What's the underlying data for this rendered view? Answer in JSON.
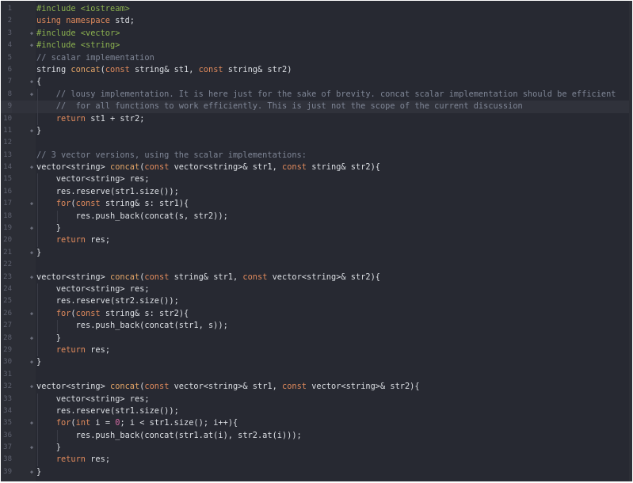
{
  "editor": {
    "theme": {
      "background": "#272932",
      "gutter": "#2b2d35",
      "preprocessor": "#8bb14f",
      "keyword": "#e08a5c",
      "function": "#e3a466",
      "comment": "#7f8696",
      "number": "#d36aa3",
      "text": "#dcdfe4"
    },
    "current_line": 9,
    "lines": [
      {
        "n": "1",
        "fold": "",
        "indent": 0,
        "tokens": [
          [
            "pp",
            "#include <iostream>"
          ]
        ]
      },
      {
        "n": "2",
        "fold": "",
        "indent": 0,
        "tokens": [
          [
            "kw",
            "using namespace"
          ],
          [
            "tx",
            " std;"
          ]
        ]
      },
      {
        "n": "3",
        "fold": "◆",
        "indent": 0,
        "tokens": [
          [
            "pp",
            "#include <vector>"
          ]
        ]
      },
      {
        "n": "4",
        "fold": "◆",
        "indent": 0,
        "tokens": [
          [
            "pp",
            "#include <string>"
          ]
        ]
      },
      {
        "n": "5",
        "fold": "",
        "indent": 0,
        "tokens": [
          [
            "cm",
            "// scalar implementation"
          ]
        ]
      },
      {
        "n": "6",
        "fold": "",
        "indent": 0,
        "tokens": [
          [
            "tx",
            "string "
          ],
          [
            "fn",
            "concat"
          ],
          [
            "tx",
            "("
          ],
          [
            "kw",
            "const"
          ],
          [
            "tx",
            " string& st1, "
          ],
          [
            "kw",
            "const"
          ],
          [
            "tx",
            " string& str2)"
          ]
        ]
      },
      {
        "n": "7",
        "fold": "◆",
        "indent": 0,
        "tokens": [
          [
            "tx",
            "{"
          ]
        ]
      },
      {
        "n": "8",
        "fold": "◆",
        "indent": 1,
        "tokens": [
          [
            "cm",
            "    // lousy implementation. It is here just for the sake of brevity. concat scalar implementation should be efficient"
          ]
        ]
      },
      {
        "n": "9",
        "fold": "",
        "indent": 1,
        "tokens": [
          [
            "cm",
            "    //  for all functions to work efficiently. This is just not the scope of the current discussion"
          ]
        ]
      },
      {
        "n": "10",
        "fold": "",
        "indent": 1,
        "tokens": [
          [
            "tx",
            "    "
          ],
          [
            "kw",
            "return"
          ],
          [
            "tx",
            " st1 + str2;"
          ]
        ]
      },
      {
        "n": "11",
        "fold": "◆",
        "indent": 0,
        "tokens": [
          [
            "tx",
            "}"
          ]
        ]
      },
      {
        "n": "12",
        "fold": "",
        "indent": 0,
        "tokens": []
      },
      {
        "n": "13",
        "fold": "",
        "indent": 0,
        "tokens": [
          [
            "cm",
            "// 3 vector versions, using the scalar implementations:"
          ]
        ]
      },
      {
        "n": "14",
        "fold": "◆",
        "indent": 0,
        "tokens": [
          [
            "tx",
            "vector<string> "
          ],
          [
            "fn",
            "concat"
          ],
          [
            "tx",
            "("
          ],
          [
            "kw",
            "const"
          ],
          [
            "tx",
            " vector<string>& str1, "
          ],
          [
            "kw",
            "const"
          ],
          [
            "tx",
            " string& str2){"
          ]
        ]
      },
      {
        "n": "15",
        "fold": "",
        "indent": 1,
        "tokens": [
          [
            "tx",
            "    vector<string> res;"
          ]
        ]
      },
      {
        "n": "16",
        "fold": "",
        "indent": 1,
        "tokens": [
          [
            "tx",
            "    res.reserve(str1.size());"
          ]
        ]
      },
      {
        "n": "17",
        "fold": "◆",
        "indent": 1,
        "tokens": [
          [
            "tx",
            "    "
          ],
          [
            "kw",
            "for"
          ],
          [
            "tx",
            "("
          ],
          [
            "kw",
            "const"
          ],
          [
            "tx",
            " string& s: str1){"
          ]
        ]
      },
      {
        "n": "18",
        "fold": "",
        "indent": 2,
        "tokens": [
          [
            "tx",
            "        res.push_back(concat(s, str2));"
          ]
        ]
      },
      {
        "n": "19",
        "fold": "◆",
        "indent": 1,
        "tokens": [
          [
            "tx",
            "    }"
          ]
        ]
      },
      {
        "n": "20",
        "fold": "",
        "indent": 1,
        "tokens": [
          [
            "tx",
            "    "
          ],
          [
            "kw",
            "return"
          ],
          [
            "tx",
            " res;"
          ]
        ]
      },
      {
        "n": "21",
        "fold": "◆",
        "indent": 0,
        "tokens": [
          [
            "tx",
            "}"
          ]
        ]
      },
      {
        "n": "22",
        "fold": "",
        "indent": 0,
        "tokens": []
      },
      {
        "n": "23",
        "fold": "◆",
        "indent": 0,
        "tokens": [
          [
            "tx",
            "vector<string> "
          ],
          [
            "fn",
            "concat"
          ],
          [
            "tx",
            "("
          ],
          [
            "kw",
            "const"
          ],
          [
            "tx",
            " string& str1, "
          ],
          [
            "kw",
            "const"
          ],
          [
            "tx",
            " vector<string>& str2){"
          ]
        ]
      },
      {
        "n": "24",
        "fold": "",
        "indent": 1,
        "tokens": [
          [
            "tx",
            "    vector<string> res;"
          ]
        ]
      },
      {
        "n": "25",
        "fold": "",
        "indent": 1,
        "tokens": [
          [
            "tx",
            "    res.reserve(str2.size());"
          ]
        ]
      },
      {
        "n": "26",
        "fold": "◆",
        "indent": 1,
        "tokens": [
          [
            "tx",
            "    "
          ],
          [
            "kw",
            "for"
          ],
          [
            "tx",
            "("
          ],
          [
            "kw",
            "const"
          ],
          [
            "tx",
            " string& s: str2){"
          ]
        ]
      },
      {
        "n": "27",
        "fold": "",
        "indent": 2,
        "tokens": [
          [
            "tx",
            "        res.push_back(concat(str1, s));"
          ]
        ]
      },
      {
        "n": "28",
        "fold": "◆",
        "indent": 1,
        "tokens": [
          [
            "tx",
            "    }"
          ]
        ]
      },
      {
        "n": "29",
        "fold": "",
        "indent": 1,
        "tokens": [
          [
            "tx",
            "    "
          ],
          [
            "kw",
            "return"
          ],
          [
            "tx",
            " res;"
          ]
        ]
      },
      {
        "n": "30",
        "fold": "◆",
        "indent": 0,
        "tokens": [
          [
            "tx",
            "}"
          ]
        ]
      },
      {
        "n": "31",
        "fold": "",
        "indent": 0,
        "tokens": []
      },
      {
        "n": "32",
        "fold": "◆",
        "indent": 0,
        "tokens": [
          [
            "tx",
            "vector<string> "
          ],
          [
            "fn",
            "concat"
          ],
          [
            "tx",
            "("
          ],
          [
            "kw",
            "const"
          ],
          [
            "tx",
            " vector<string>& str1, "
          ],
          [
            "kw",
            "const"
          ],
          [
            "tx",
            " vector<string>& str2){"
          ]
        ]
      },
      {
        "n": "33",
        "fold": "",
        "indent": 1,
        "tokens": [
          [
            "tx",
            "    vector<string> res;"
          ]
        ]
      },
      {
        "n": "34",
        "fold": "",
        "indent": 1,
        "tokens": [
          [
            "tx",
            "    res.reserve(str1.size());"
          ]
        ]
      },
      {
        "n": "35",
        "fold": "◆",
        "indent": 1,
        "tokens": [
          [
            "tx",
            "    "
          ],
          [
            "kw",
            "for"
          ],
          [
            "tx",
            "("
          ],
          [
            "kw",
            "int"
          ],
          [
            "tx",
            " i = "
          ],
          [
            "num",
            "0"
          ],
          [
            "tx",
            "; i < str1.size(); i++){"
          ]
        ]
      },
      {
        "n": "36",
        "fold": "",
        "indent": 2,
        "tokens": [
          [
            "tx",
            "        res.push_back(concat(str1.at(i), str2.at(i)));"
          ]
        ]
      },
      {
        "n": "37",
        "fold": "◆",
        "indent": 1,
        "tokens": [
          [
            "tx",
            "    }"
          ]
        ]
      },
      {
        "n": "38",
        "fold": "",
        "indent": 1,
        "tokens": [
          [
            "tx",
            "    "
          ],
          [
            "kw",
            "return"
          ],
          [
            "tx",
            " res;"
          ]
        ]
      },
      {
        "n": "39",
        "fold": "◆",
        "indent": 0,
        "tokens": [
          [
            "tx",
            "}"
          ]
        ]
      }
    ]
  }
}
